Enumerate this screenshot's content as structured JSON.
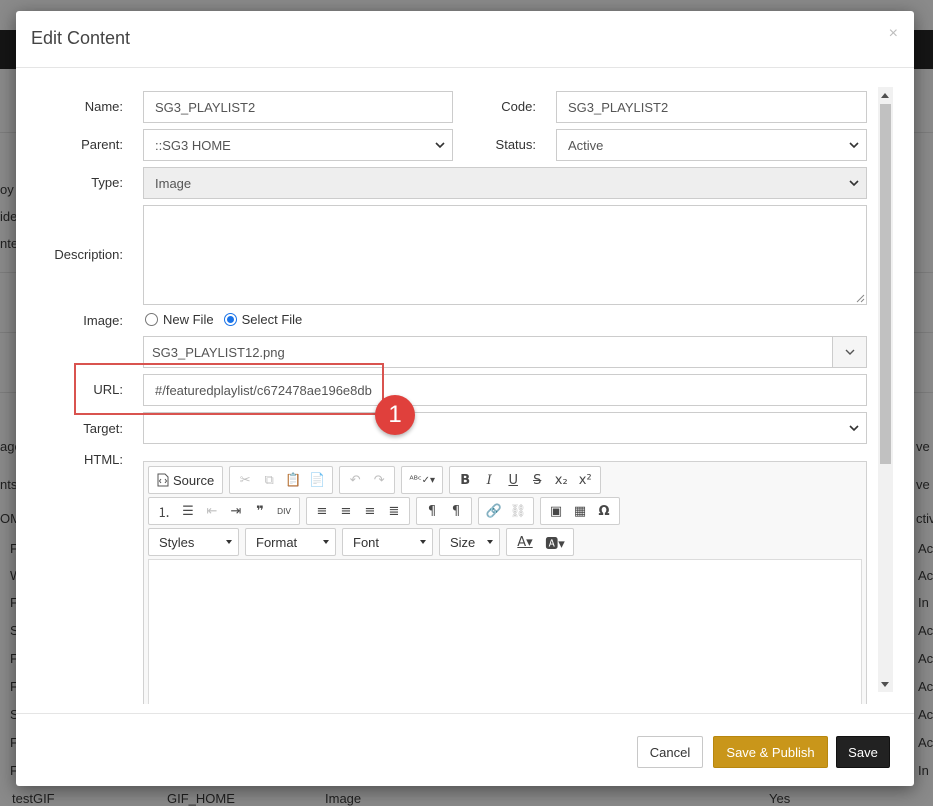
{
  "modal": {
    "title": "Edit Content",
    "close": "×"
  },
  "form": {
    "name_label": "Name:",
    "name_value": "SG3_PLAYLIST2",
    "code_label": "Code:",
    "code_value": "SG3_PLAYLIST2",
    "parent_label": "Parent:",
    "parent_value": "::SG3 HOME",
    "status_label": "Status:",
    "status_value": "Active",
    "type_label": "Type:",
    "type_value": "Image",
    "description_label": "Description:",
    "description_value": "",
    "image_label": "Image:",
    "image_option_new": "New File",
    "image_option_select": "Select File",
    "file_value": "SG3_PLAYLIST12.png",
    "url_label": "URL:",
    "url_value": "#/featuredplaylist/c672478ae196e8db",
    "target_label": "Target:",
    "target_value": "",
    "html_label": "HTML:"
  },
  "editor": {
    "source_label": "Source",
    "styles_label": "Styles",
    "format_label": "Format",
    "font_label": "Font",
    "size_label": "Size"
  },
  "annotation": {
    "badge": "1",
    "color": "#d9534f"
  },
  "footer": {
    "cancel_label": "Cancel",
    "publish_label": "Save & Publish",
    "save_label": "Save",
    "publish_color": "#c9961a"
  },
  "background": {
    "left_fragments": [
      "oy",
      "ide",
      "nte",
      "age",
      "nts",
      "OM",
      "F",
      "W",
      "F",
      "S",
      "F",
      "F",
      "S",
      "F",
      "F"
    ],
    "right_fragments": [
      "ve",
      "ve",
      "ctiv",
      "Ac",
      "Ac",
      "In",
      "Ac",
      "Ac",
      "Ac",
      "Ac",
      "Ac",
      "In"
    ],
    "bottom_row": [
      "testGIF",
      "GIF_HOME",
      "Image",
      "Yes"
    ]
  }
}
